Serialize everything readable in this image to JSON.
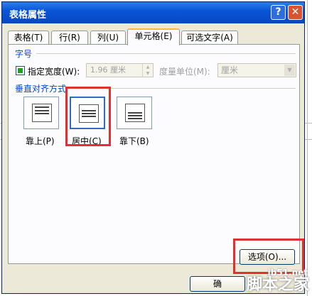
{
  "dialog": {
    "title": "表格属性"
  },
  "titlebar": {
    "help_label": "?",
    "close_label": "✕"
  },
  "tabs": [
    {
      "label": "表格(T)"
    },
    {
      "label": "行(R)"
    },
    {
      "label": "列(U)"
    },
    {
      "label": "单元格(E)"
    },
    {
      "label": "可选文字(A)"
    }
  ],
  "size_group": {
    "title": "字号",
    "specify_width_label": "指定宽度(W):",
    "width_value": "1.96 厘米",
    "unit_label": "度量单位(M):",
    "unit_value": "厘米"
  },
  "vertical_group": {
    "title": "垂直对齐方式",
    "options": [
      {
        "label": "靠上(P)"
      },
      {
        "label": "居中(C)"
      },
      {
        "label": "靠下(B)"
      }
    ]
  },
  "buttons": {
    "options_label": "选项(O)...",
    "ok_label": "确"
  },
  "watermark": {
    "url": "jb51.net",
    "text": "脚本之家"
  },
  "colors": {
    "highlight": "#e03030",
    "titlebar": "#0a55d8"
  }
}
